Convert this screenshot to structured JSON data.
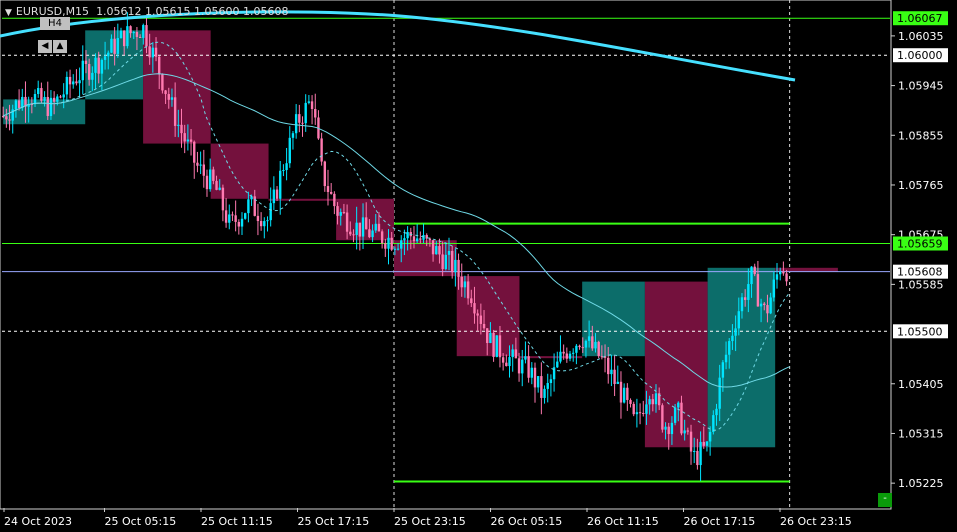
{
  "header": {
    "symbol": "EURUSD,M15",
    "ohlc": "1.05612 1.05615 1.05600 1.05608",
    "timeframe_button": "H4",
    "nav_left": "◀",
    "nav_up": "▲"
  },
  "minimize_label": "-",
  "colors": {
    "background": "#000000",
    "bull_candle": "#00e5ff",
    "bear_candle": "#ff7ab0",
    "bull_box": "#0c6d6a",
    "bear_box": "#74113d",
    "level_line": "#39ff14",
    "ma_slow": "#46e0ff",
    "ma_fast": "#6fd9e6",
    "grid": "#cfcfcf"
  },
  "chart_data": {
    "type": "candlestick",
    "symbol": "EURUSD",
    "timeframe": "M15",
    "ylim": [
      1.0518,
      1.061
    ],
    "y_ticks": [
      "1.06035",
      "1.05945",
      "1.05855",
      "1.05765",
      "1.05675",
      "1.05585",
      "1.05405",
      "1.05315",
      "1.05225"
    ],
    "x_ticks": [
      "24 Oct 2023",
      "25 Oct 05:15",
      "25 Oct 11:15",
      "25 Oct 17:15",
      "25 Oct 23:15",
      "26 Oct 05:15",
      "26 Oct 11:15",
      "26 Oct 17:15",
      "26 Oct 23:15"
    ],
    "highlight_labels": [
      {
        "value": "1.06067",
        "kind": "green"
      },
      {
        "value": "1.06000",
        "kind": "white"
      },
      {
        "value": "1.05659",
        "kind": "green"
      },
      {
        "value": "1.05608",
        "kind": "white"
      },
      {
        "value": "1.05500",
        "kind": "white"
      }
    ],
    "horizontal_levels": [
      {
        "price": 1.06067,
        "style": "solid",
        "color": "green"
      },
      {
        "price": 1.06,
        "style": "dotted",
        "color": "white"
      },
      {
        "price": 1.05659,
        "style": "solid",
        "color": "green"
      },
      {
        "price": 1.05608,
        "style": "solid",
        "color": "blue"
      },
      {
        "price": 1.055,
        "style": "dotted",
        "color": "white"
      }
    ],
    "short_levels": [
      {
        "price": 1.05695,
        "from_tick": 4,
        "to_tick": 8.1
      },
      {
        "price": 1.05228,
        "from_tick": 4,
        "to_tick": 8.1
      }
    ],
    "h4_boxes": [
      {
        "start": -0.05,
        "end": 0.8,
        "open": 1.05875,
        "close": 1.0592,
        "dir": "bull"
      },
      {
        "start": 0.8,
        "end": 1.4,
        "open": 1.0592,
        "close": 1.06045,
        "dir": "bull"
      },
      {
        "start": 1.4,
        "end": 2.1,
        "open": 1.06045,
        "close": 1.0584,
        "dir": "bear"
      },
      {
        "start": 2.1,
        "end": 2.7,
        "open": 1.0584,
        "close": 1.0574,
        "dir": "bear"
      },
      {
        "start": 2.7,
        "end": 3.4,
        "open": 1.0574,
        "close": 1.0574,
        "dir": "bear"
      },
      {
        "start": 3.4,
        "end": 4.0,
        "open": 1.0574,
        "close": 1.05665,
        "dir": "bear"
      },
      {
        "start": 4.0,
        "end": 4.65,
        "open": 1.05665,
        "close": 1.056,
        "dir": "bear"
      },
      {
        "start": 4.65,
        "end": 5.3,
        "open": 1.056,
        "close": 1.05455,
        "dir": "bear"
      },
      {
        "start": 5.3,
        "end": 5.95,
        "open": 1.05455,
        "close": 1.05455,
        "dir": "bear"
      },
      {
        "start": 5.95,
        "end": 6.6,
        "open": 1.05455,
        "close": 1.0559,
        "dir": "bull"
      },
      {
        "start": 6.6,
        "end": 7.25,
        "open": 1.0559,
        "close": 1.0529,
        "dir": "bear"
      },
      {
        "start": 7.25,
        "end": 7.95,
        "open": 1.0529,
        "close": 1.05615,
        "dir": "bull"
      },
      {
        "start": 7.95,
        "end": 8.6,
        "open": 1.05615,
        "close": 1.05608,
        "dir": "bear"
      }
    ],
    "price_path": [
      [
        -0.05,
        1.0589
      ],
      [
        0.2,
        1.0593
      ],
      [
        0.45,
        1.05905
      ],
      [
        0.7,
        1.0596
      ],
      [
        0.95,
        1.0599
      ],
      [
        1.2,
        1.06035
      ],
      [
        1.4,
        1.0605
      ],
      [
        1.55,
        1.0598
      ],
      [
        1.75,
        1.0588
      ],
      [
        1.95,
        1.058
      ],
      [
        2.15,
        1.0576
      ],
      [
        2.3,
        1.0569
      ],
      [
        2.5,
        1.0573
      ],
      [
        2.7,
        1.057
      ],
      [
        2.85,
        1.058
      ],
      [
        3.0,
        1.0588
      ],
      [
        3.15,
        1.0592
      ],
      [
        3.25,
        1.0579
      ],
      [
        3.4,
        1.0572
      ],
      [
        3.6,
        1.0569
      ],
      [
        3.8,
        1.05675
      ],
      [
        4.0,
        1.05665
      ],
      [
        4.2,
        1.05675
      ],
      [
        4.4,
        1.0565
      ],
      [
        4.6,
        1.0562
      ],
      [
        4.8,
        1.0557
      ],
      [
        5.0,
        1.0548
      ],
      [
        5.2,
        1.0545
      ],
      [
        5.4,
        1.0543
      ],
      [
        5.55,
        1.0538
      ],
      [
        5.75,
        1.0546
      ],
      [
        5.95,
        1.0549
      ],
      [
        6.15,
        1.0545
      ],
      [
        6.35,
        1.0539
      ],
      [
        6.5,
        1.0533
      ],
      [
        6.65,
        1.054
      ],
      [
        6.8,
        1.0533
      ],
      [
        6.95,
        1.0535
      ],
      [
        7.1,
        1.0527
      ],
      [
        7.25,
        1.0529
      ],
      [
        7.4,
        1.0543
      ],
      [
        7.55,
        1.0553
      ],
      [
        7.7,
        1.056
      ],
      [
        7.85,
        1.0553
      ],
      [
        8.0,
        1.0562
      ],
      [
        8.1,
        1.05608
      ]
    ]
  }
}
